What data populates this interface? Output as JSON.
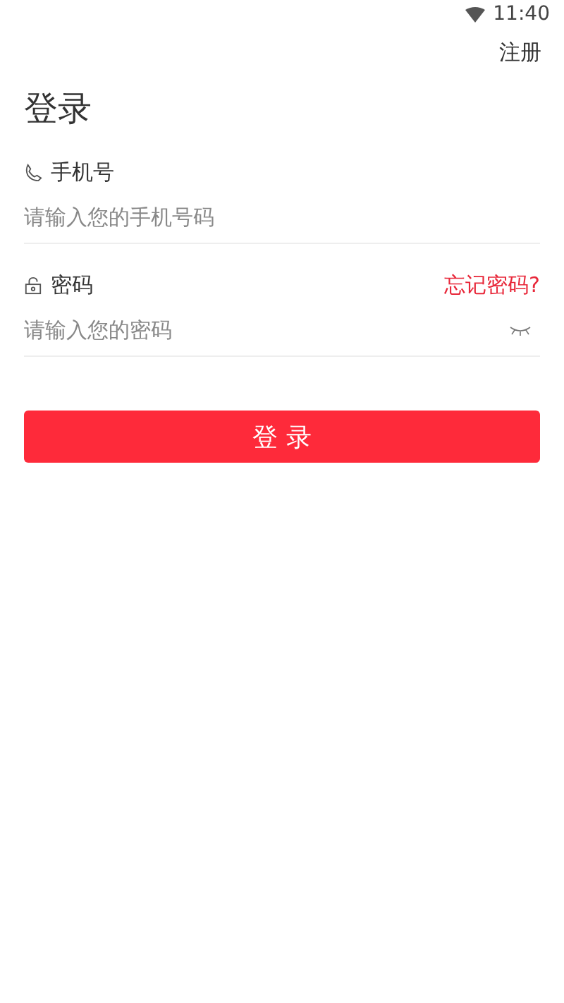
{
  "status_bar": {
    "time": "11:40"
  },
  "header": {
    "register_link": "注册"
  },
  "title": "登录",
  "fields": [
    {
      "kind": "phone",
      "label": "手机号",
      "placeholder": "请输入您的手机号码"
    },
    {
      "kind": "password",
      "label": "密码",
      "forgot_link": "忘记密码?",
      "placeholder": "请输入您的密码"
    }
  ],
  "login_button": "登 录"
}
